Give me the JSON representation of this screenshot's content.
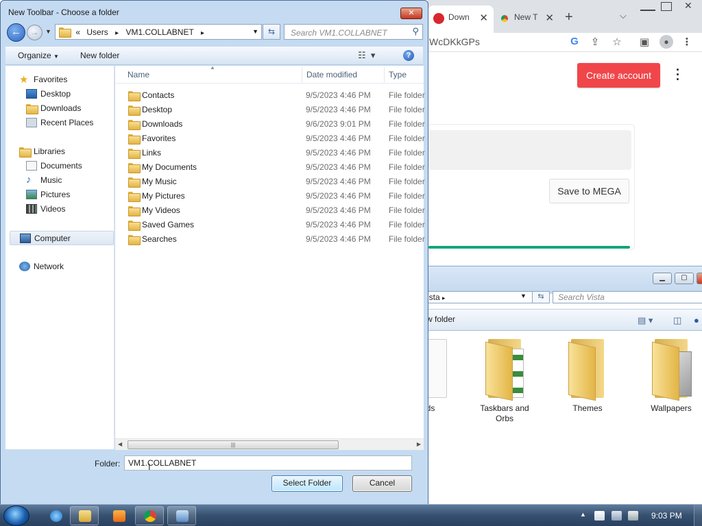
{
  "dialog": {
    "title": "New Toolbar - Choose a folder",
    "close_symbol": "✕",
    "breadcrumb": {
      "overflow": "«",
      "items": [
        "Users",
        "VM1.COLLABNET"
      ],
      "separator": "▸"
    },
    "search_placeholder": "Search VM1.COLLABNET",
    "toolbar": {
      "organize": "Organize",
      "new_folder": "New folder"
    },
    "nav": {
      "favorites": "Favorites",
      "desktop": "Desktop",
      "downloads": "Downloads",
      "recent_places": "Recent Places",
      "libraries": "Libraries",
      "documents": "Documents",
      "music": "Music",
      "pictures": "Pictures",
      "videos": "Videos",
      "computer": "Computer",
      "network": "Network"
    },
    "columns": {
      "name": "Name",
      "date": "Date modified",
      "type": "Type"
    },
    "files": [
      {
        "name": "Contacts",
        "date": "9/5/2023 4:46 PM",
        "type": "File folder"
      },
      {
        "name": "Desktop",
        "date": "9/5/2023 4:46 PM",
        "type": "File folder"
      },
      {
        "name": "Downloads",
        "date": "9/6/2023 9:01 PM",
        "type": "File folder"
      },
      {
        "name": "Favorites",
        "date": "9/5/2023 4:46 PM",
        "type": "File folder"
      },
      {
        "name": "Links",
        "date": "9/5/2023 4:46 PM",
        "type": "File folder"
      },
      {
        "name": "My Documents",
        "date": "9/5/2023 4:46 PM",
        "type": "File folder"
      },
      {
        "name": "My Music",
        "date": "9/5/2023 4:46 PM",
        "type": "File folder"
      },
      {
        "name": "My Pictures",
        "date": "9/5/2023 4:46 PM",
        "type": "File folder"
      },
      {
        "name": "My Videos",
        "date": "9/5/2023 4:46 PM",
        "type": "File folder"
      },
      {
        "name": "Saved Games",
        "date": "9/5/2023 4:46 PM",
        "type": "File folder"
      },
      {
        "name": "Searches",
        "date": "9/5/2023 4:46 PM",
        "type": "File folder"
      }
    ],
    "folder_label": "Folder:",
    "folder_value": "VM1.COLLABNET",
    "select_button": "Select Folder",
    "cancel_button": "Cancel"
  },
  "chrome": {
    "tabs": [
      {
        "label": "Down",
        "icon": "mega-icon",
        "active": true
      },
      {
        "label": "New T",
        "icon": "chrome-icon",
        "active": false
      }
    ],
    "url_fragment": "WcDKkGPs",
    "create_account": "Create account",
    "save_to_mega": "Save to MEGA"
  },
  "explorer": {
    "address_fragment": "ista",
    "search_placeholder": "Search Vista",
    "new_folder_fragment": "w folder",
    "items": [
      {
        "label": "ds"
      },
      {
        "label": "Taskbars and Orbs"
      },
      {
        "label": "Themes"
      },
      {
        "label": "Wallpapers"
      }
    ]
  },
  "taskbar": {
    "clock": "9:03 PM",
    "apps": [
      "internet-explorer",
      "windows-explorer",
      "media-player",
      "chrome",
      "control-panel"
    ]
  },
  "colors": {
    "title_bar": "#c5dbf2",
    "create_account_button": "#f0464a",
    "progress_green": "#11a57a",
    "taskbar": "#36506f"
  }
}
